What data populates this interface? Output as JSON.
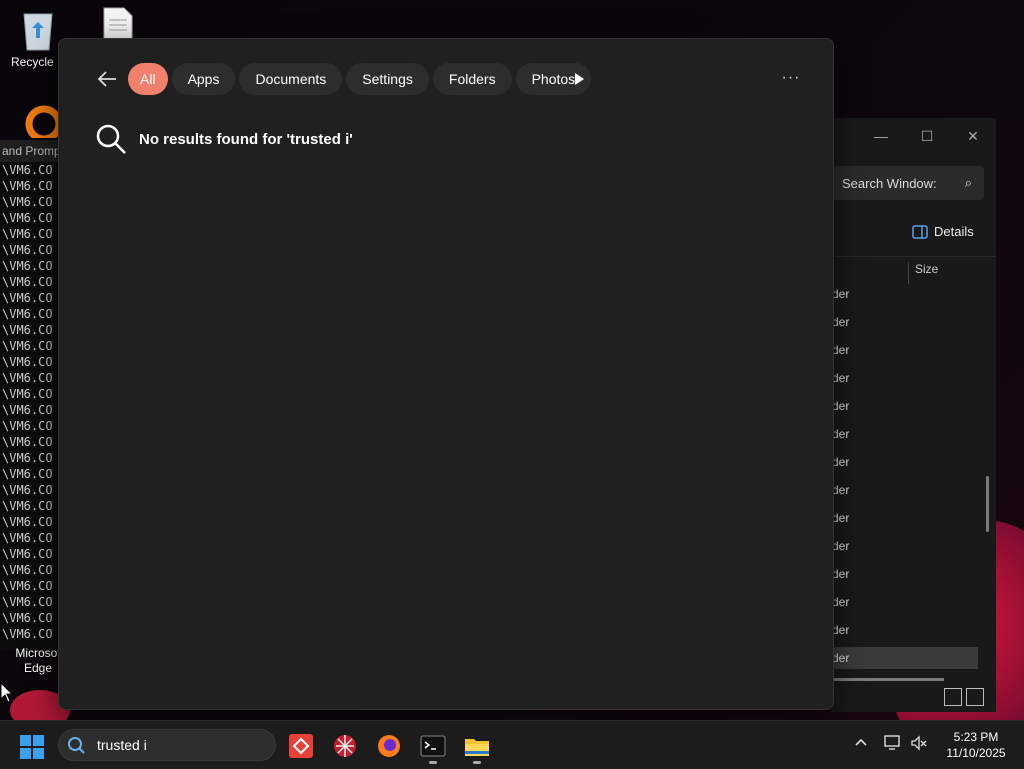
{
  "desktop": {
    "recycle_bin_label": "Recycle B",
    "edge_label_line1": "Microsof",
    "edge_label_line2": "Edge"
  },
  "cmd": {
    "title": "and Promp",
    "lines": [
      "\\VM6.CO",
      "\\VM6.CO",
      "\\VM6.CO",
      "\\VM6.CO",
      "\\VM6.CO",
      "\\VM6.CO",
      "\\VM6.CO",
      "\\VM6.CO",
      "\\VM6.CO",
      "\\VM6.CO",
      "\\VM6.CO",
      "\\VM6.CO",
      "\\VM6.CO",
      "\\VM6.CO",
      "\\VM6.CO",
      "\\VM6.CO",
      "\\VM6.CO",
      "\\VM6.CO",
      "\\VM6.CO",
      "\\VM6.CO",
      "\\VM6.CO",
      "\\VM6.CO",
      "\\VM6.CO",
      "\\VM6.CO",
      "\\VM6.CO",
      "\\VM6.CO",
      "\\VM6.CO",
      "\\VM6.CO",
      "\\VM6.CO",
      "\\VM6.CO"
    ]
  },
  "explorer": {
    "search_placeholder": "Search Window:",
    "details_label": "Details",
    "size_header": "Size",
    "row_text": "der"
  },
  "search_panel": {
    "filters": [
      "All",
      "Apps",
      "Documents",
      "Settings",
      "Folders",
      "Photos"
    ],
    "active_filter": "All",
    "more_label": "···",
    "no_results_text": "No results found for 'trusted i'"
  },
  "taskbar": {
    "search_value": "trusted i",
    "clock_time": "5:23 PM",
    "clock_date": "11/10/2025"
  },
  "colors": {
    "accent_pill": "#f0806c",
    "panel_bg": "#202020",
    "pill_bg": "#2d2d2d"
  }
}
